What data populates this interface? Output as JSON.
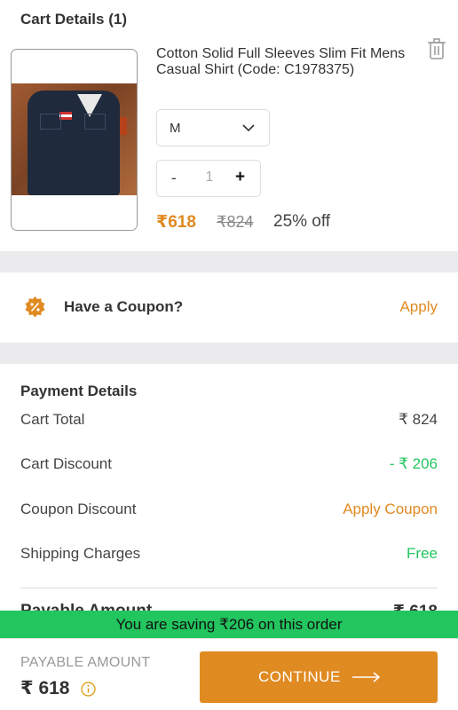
{
  "cart": {
    "title": "Cart Details (1)",
    "product": {
      "name": "Cotton Solid Full Sleeves Slim Fit Mens Casual Shirt (Code: C1978375)",
      "size": "M",
      "quantity": "1",
      "qty_minus": "-",
      "qty_plus": "+",
      "price": "₹618",
      "mrp": "₹824",
      "discount": "25% off"
    },
    "icons": {
      "delete": "trash-icon",
      "size_toggle": "chevron-down-icon"
    }
  },
  "coupon": {
    "label": "Have a Coupon?",
    "action": "Apply",
    "icon": "percent-badge-icon"
  },
  "payment": {
    "title": "Payment Details",
    "rows": [
      {
        "label": "Cart Total",
        "value": "₹  824"
      },
      {
        "label": "Cart Discount",
        "value": "- ₹  206"
      },
      {
        "label": "Coupon Discount",
        "value": "Apply Coupon"
      },
      {
        "label": "Shipping Charges",
        "value": "Free"
      }
    ],
    "payable_label": "Payable Amount",
    "payable_value": "₹ 618"
  },
  "saving_banner": "You are saving ₹206 on this order",
  "footer": {
    "label": "PAYABLE AMOUNT",
    "amount": "₹ 618",
    "button": "CONTINUE"
  },
  "colors": {
    "accent": "#e08a22",
    "success": "#22c55e",
    "section_gap": "#ebebee"
  }
}
